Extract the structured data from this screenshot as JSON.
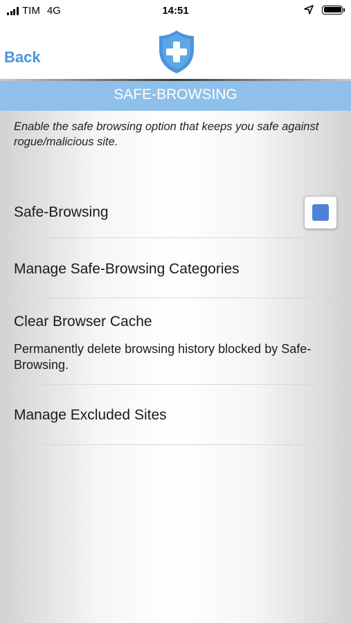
{
  "status_bar": {
    "carrier": "TIM",
    "network": "4G",
    "time": "14:51",
    "icons": [
      "signal-icon",
      "location-arrow-icon",
      "battery-icon"
    ]
  },
  "nav": {
    "back_label": "Back",
    "logo_icon": "shield-cross-icon",
    "accent_color": "#4a95db"
  },
  "header": {
    "title": "SAFE-BROWSING",
    "color": "#8ec0ea"
  },
  "intro": "Enable the safe browsing option that keeps you safe against rogue/malicious site.",
  "settings": {
    "safe_browsing": {
      "label": "Safe-Browsing",
      "checked": true
    },
    "categories": {
      "label": "Manage Safe-Browsing Categories"
    },
    "cache": {
      "label": "Clear Browser Cache",
      "description": "Permanently delete browsing history blocked by Safe-Browsing."
    },
    "excluded": {
      "label": "Manage Excluded Sites"
    }
  }
}
